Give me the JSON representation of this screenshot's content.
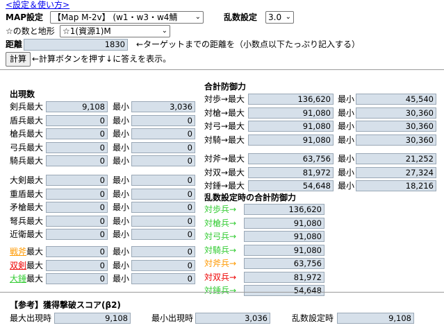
{
  "header": {
    "settings_link": "<設定＆使い方>"
  },
  "map": {
    "label": "MAP設定",
    "select_value": "【Map M-2v】 (w1・w3・w4鯖",
    "random_label": "乱数設定",
    "random_value": "3.0"
  },
  "stars": {
    "label": "☆の数と地形",
    "select_value": "☆1(資源1)M"
  },
  "distance": {
    "label": "距離",
    "value": "1830",
    "hint": "←ターゲットまでの距離を（小数点以下たっぷり記入する）"
  },
  "calc": {
    "button": "計算",
    "hint": "←計算ボタンを押す↓に答えを表示。"
  },
  "appear": {
    "title": "出現数",
    "min_label": "最小",
    "group1": [
      {
        "label": "剣兵最大",
        "max": "9,108",
        "min": "3,036"
      },
      {
        "label": "盾兵最大",
        "max": "0",
        "min": "0"
      },
      {
        "label": "槍兵最大",
        "max": "0",
        "min": "0"
      },
      {
        "label": "弓兵最大",
        "max": "0",
        "min": "0"
      },
      {
        "label": "騎兵最大",
        "max": "0",
        "min": "0"
      }
    ],
    "group2": [
      {
        "label": "大剣最大",
        "max": "0",
        "min": "0"
      },
      {
        "label": "重盾最大",
        "max": "0",
        "min": "0"
      },
      {
        "label": "矛槍最大",
        "max": "0",
        "min": "0"
      },
      {
        "label": "弩兵最大",
        "max": "0",
        "min": "0"
      },
      {
        "label": "近衛最大",
        "max": "0",
        "min": "0"
      }
    ],
    "group3": [
      {
        "prefix": "戦斧",
        "suffix": "最大",
        "max": "0",
        "min": "0"
      },
      {
        "prefix": "双剣",
        "suffix": "最大",
        "max": "0",
        "min": "0"
      },
      {
        "prefix": "大錘",
        "suffix": "最大",
        "max": "0",
        "min": "0"
      }
    ],
    "colors": {
      "axe": "#ff9900",
      "sword": "#ee0000",
      "hammer": "#33cc33"
    }
  },
  "defense": {
    "title": "合計防御力",
    "min_label": "最小",
    "group1": [
      {
        "label": "対歩→最大",
        "max": "136,620",
        "min": "45,540"
      },
      {
        "label": "対槍→最大",
        "max": "91,080",
        "min": "30,360"
      },
      {
        "label": "対弓→最大",
        "max": "91,080",
        "min": "30,360"
      },
      {
        "label": "対騎→最大",
        "max": "91,080",
        "min": "30,360"
      }
    ],
    "group2": [
      {
        "label": "対斧→最大",
        "max": "63,756",
        "min": "21,252"
      },
      {
        "label": "対双→最大",
        "max": "81,972",
        "min": "27,324"
      },
      {
        "label": "対錘→最大",
        "max": "54,648",
        "min": "18,216"
      }
    ]
  },
  "random_defense": {
    "title": "乱数設定時の合計防御力",
    "rows": [
      {
        "label": "対歩兵→",
        "value": "136,620"
      },
      {
        "label": "対槍兵→",
        "value": "91,080"
      },
      {
        "label": "対弓兵→",
        "value": "91,080"
      },
      {
        "label": "対騎兵→",
        "value": "91,080"
      },
      {
        "label": "対斧兵→",
        "value": "63,756"
      },
      {
        "label": "対双兵→",
        "value": "81,972"
      },
      {
        "label": "対錘兵→",
        "value": "54,648"
      }
    ]
  },
  "score": {
    "title": "【参考】獲得撃破スコア(β2)",
    "max_label": "最大出現時",
    "max_value": "9,108",
    "min_label": "最小出現時",
    "min_value": "3,036",
    "random_label": "乱数設定時",
    "random_value": "9,108"
  }
}
